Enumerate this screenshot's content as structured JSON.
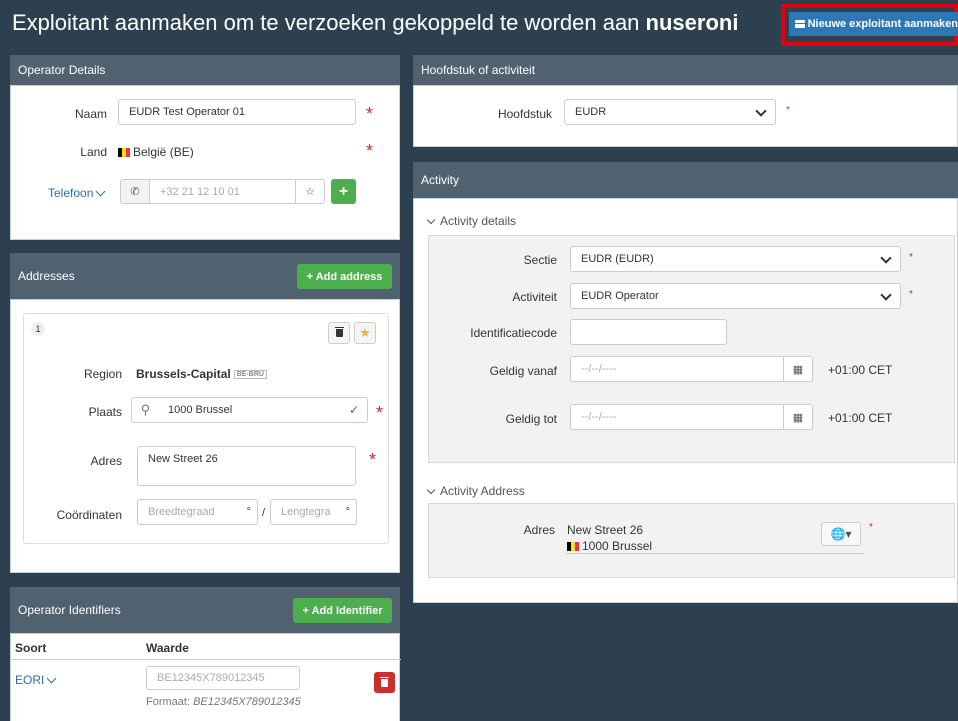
{
  "header": {
    "title_prefix": "Exploitant aanmaken om te verzoeken gekoppeld te worden aan",
    "title_bold": "nuseroni",
    "new_operator_button": "Nieuwe exploitant aanmaken"
  },
  "operator_details": {
    "heading": "Operator Details",
    "name_label": "Naam",
    "name_value": "EUDR Test Operator 01",
    "country_label": "Land",
    "country_value": "België (BE)",
    "phone_label": "Telefoon",
    "phone_placeholder": "+32 21 12 10 01",
    "required_mark": "*"
  },
  "addresses": {
    "heading": "Addresses",
    "add_button": "+ Add address",
    "index": "1",
    "region_label": "Region",
    "region_value": "Brussels-Capital",
    "region_code": "BE-BRU",
    "place_label": "Plaats",
    "place_value": "1000 Brussel",
    "address_label": "Adres",
    "address_value": "New Street 26",
    "coords_label": "Coördinaten",
    "lat_placeholder": "Breedtegraad",
    "lon_placeholder": "Lengtegra",
    "degree": "°",
    "separator": "/"
  },
  "identifiers": {
    "heading": "Operator Identifiers",
    "add_button": "+ Add Identifier",
    "col_type": "Soort",
    "col_value": "Waarde",
    "type_value": "EORI",
    "value_placeholder": "BE12345X789012345",
    "format_label": "Formaat:",
    "format_value": "BE12345X789012345"
  },
  "chapter": {
    "heading": "Hoofdstuk of activiteit",
    "label": "Hoofdstuk",
    "value": "EUDR"
  },
  "activity": {
    "heading": "Activity",
    "details_toggle": "Activity details",
    "section_label": "Sectie",
    "section_value": "EUDR (EUDR)",
    "activity_label": "Activiteit",
    "activity_value": "EUDR Operator",
    "id_label": "Identificatiecode",
    "valid_from_label": "Geldig vanaf",
    "valid_to_label": "Geldig tot",
    "date_placeholder": "--/--/----",
    "timezone": "+01:00 CET",
    "address_toggle": "Activity Address",
    "address_label": "Adres",
    "address_line1": "New Street 26",
    "address_line2": "1000 Brussel"
  },
  "colors": {
    "page_bg": "#2d4050",
    "panel_header": "#506170",
    "primary": "#2f76b5",
    "success": "#4cae4c",
    "danger": "#c9302c",
    "highlight": "#e3000f"
  }
}
